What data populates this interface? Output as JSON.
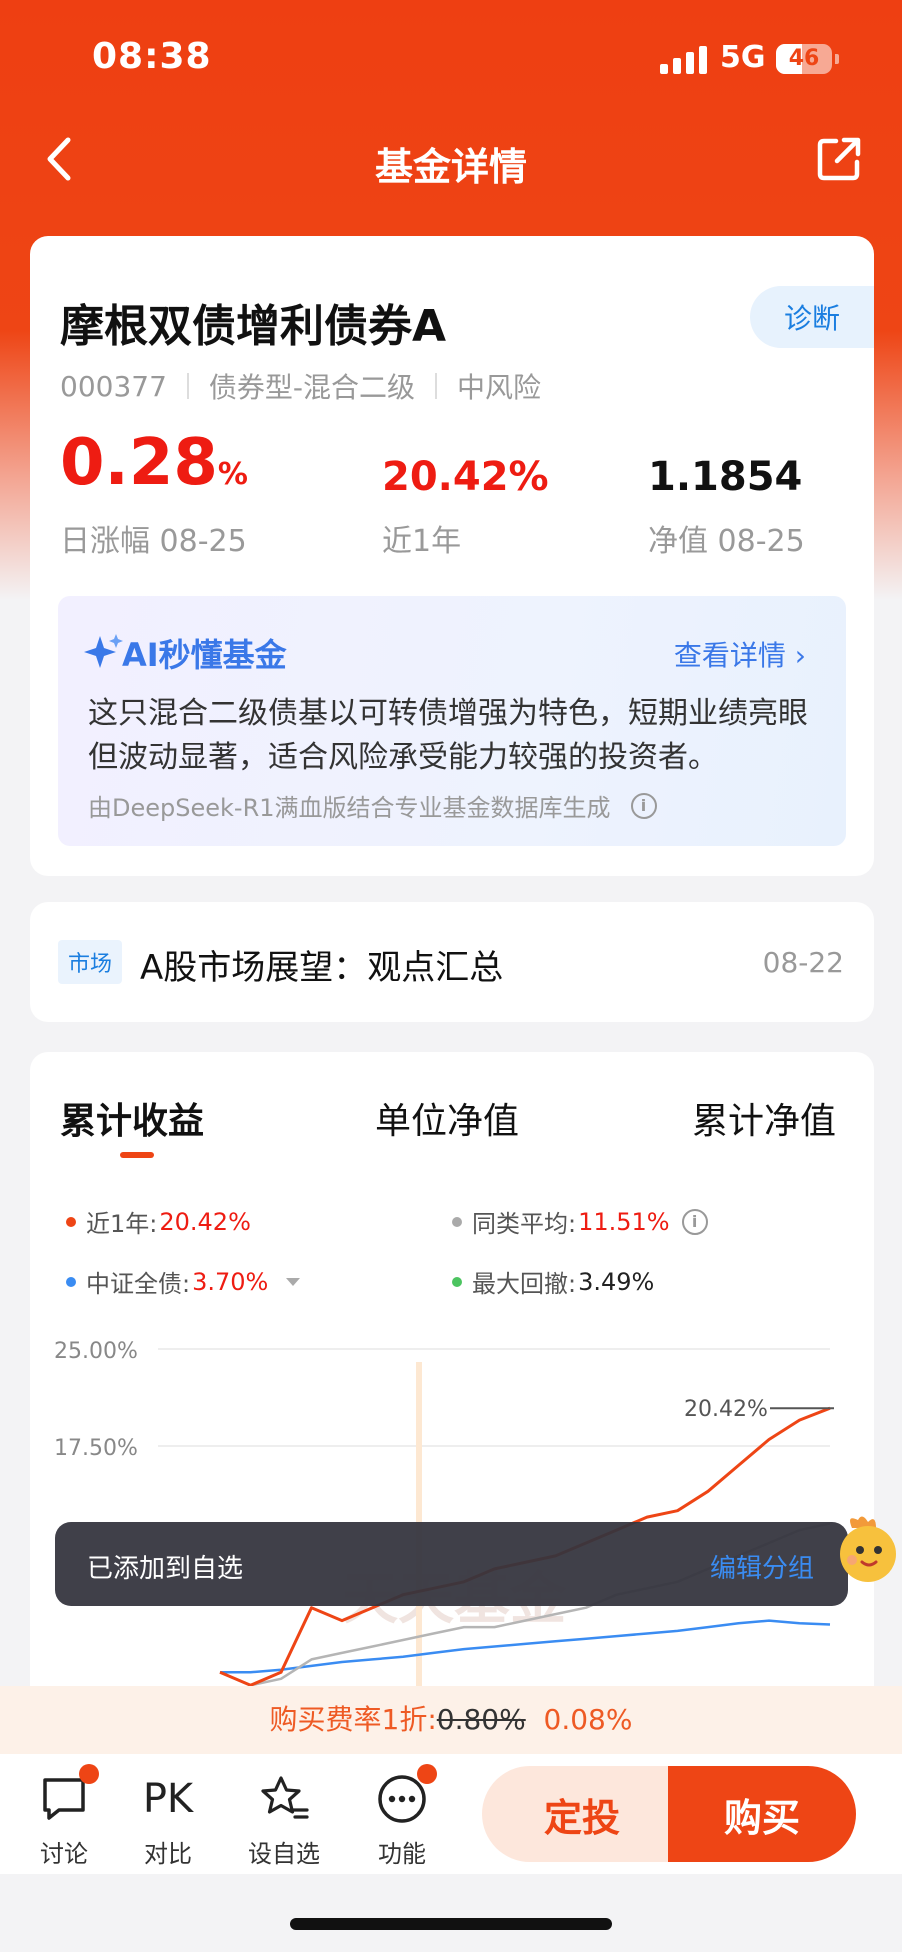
{
  "status_bar": {
    "time": "08:38",
    "network": "5G",
    "battery": "46"
  },
  "nav": {
    "title": "基金详情",
    "back_icon": "chevron-left-icon",
    "share_icon": "share-icon"
  },
  "fund": {
    "name": "摩根双债增利债券A",
    "code": "000377",
    "type": "债券型-混合二级",
    "risk": "中风险",
    "diagnose_label": "诊断",
    "daily_change": "0.28",
    "daily_change_unit": "%",
    "daily_change_label": "日涨幅 08-25",
    "year_return": "20.42%",
    "year_return_label": "近1年",
    "nav_value": "1.1854",
    "nav_label": "净值 08-25"
  },
  "ai": {
    "title": "AI秒懂基金",
    "more": "查看详情 ›",
    "summary": "这只混合二级债基以可转债增强为特色，短期业绩亮眼但波动显著，适合风险承受能力较强的投资者。",
    "footnote": "由DeepSeek-R1满血版结合专业基金数据库生成"
  },
  "news": {
    "tag": "市场",
    "title": "A股市场展望：观点汇总",
    "date": "08-22"
  },
  "chart_tabs": [
    "累计收益",
    "单位净值",
    "累计净值"
  ],
  "legend": {
    "near_year_label": "近1年:",
    "near_year_value": "20.42%",
    "category_avg_label": "同类平均:",
    "category_avg_value": "11.51%",
    "csi_bond_label": "中证全债:",
    "csi_bond_value": "3.70%",
    "max_drawdown_label": "最大回撤:",
    "max_drawdown_value": "3.49%"
  },
  "colors": {
    "fund": "#ee4515",
    "category": "#b5b5b5",
    "index": "#3a8cf2",
    "drawdown": "#4cc460",
    "accent": "#ee4515"
  },
  "chart_data": {
    "type": "line",
    "y_tick_labels": [
      "25.00%",
      "17.50%"
    ],
    "ylim": [
      -5,
      25
    ],
    "end_label": "20.42%",
    "series": [
      {
        "name": "近1年",
        "values": [
          0,
          -1,
          0,
          5,
          4,
          5,
          6,
          6.5,
          7,
          8,
          8.5,
          9,
          10,
          11,
          12,
          12.5,
          14,
          16,
          18,
          19.5,
          20.42
        ]
      },
      {
        "name": "同类平均",
        "values": [
          0,
          -1,
          -0.5,
          1,
          1.5,
          2,
          2.5,
          3,
          3.5,
          3.5,
          4,
          4.5,
          5,
          6,
          6.5,
          7,
          8,
          9,
          10,
          11,
          11.51
        ]
      },
      {
        "name": "中证全债",
        "values": [
          0,
          0,
          0.2,
          0.5,
          0.8,
          1,
          1.2,
          1.5,
          1.8,
          2,
          2.2,
          2.4,
          2.6,
          2.8,
          3,
          3.2,
          3.5,
          3.8,
          4,
          3.8,
          3.7
        ]
      }
    ],
    "watermark": "天天基金"
  },
  "toast": {
    "message": "已添加到自选",
    "action": "编辑分组"
  },
  "fee": {
    "prefix": "购买费率1折:",
    "original": "0.80%",
    "current": "0.08%"
  },
  "bottom_nav": {
    "discuss": "讨论",
    "compare": "对比",
    "compare_glyph": "PK",
    "watchlist": "设自选",
    "functions": "功能",
    "invest_button": "定投",
    "buy_button": "购买"
  }
}
